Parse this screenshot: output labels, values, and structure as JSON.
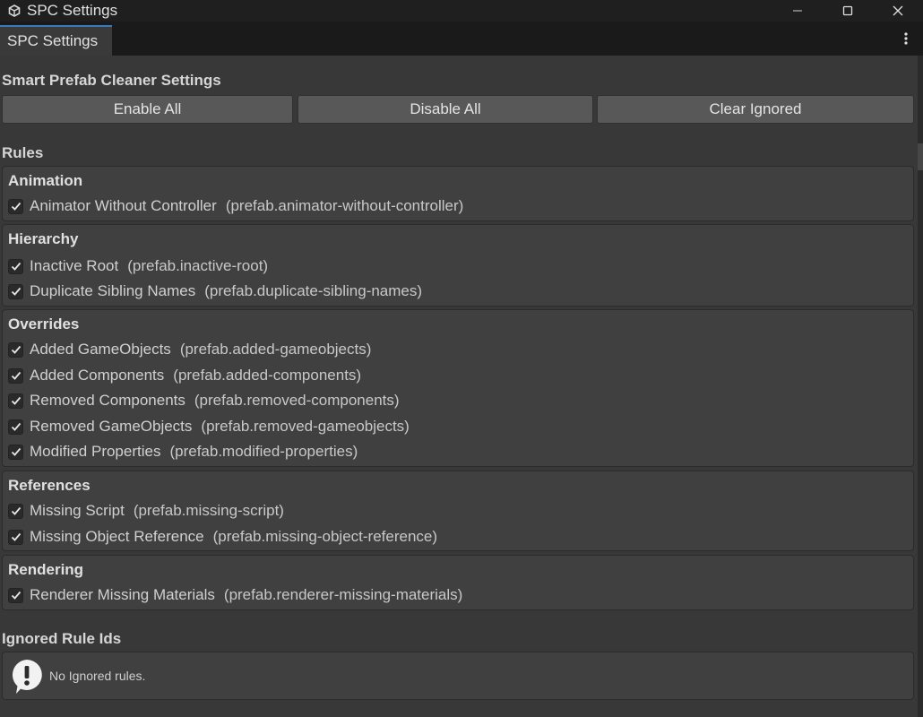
{
  "window": {
    "title": "SPC Settings"
  },
  "tab": {
    "label": "SPC Settings"
  },
  "header": "Smart Prefab Cleaner Settings",
  "buttons": {
    "enable_all": "Enable All",
    "disable_all": "Disable All",
    "clear_ignored": "Clear Ignored"
  },
  "rules_label": "Rules",
  "groups": [
    {
      "title": "Animation",
      "rules": [
        {
          "name": "Animator Without Controller",
          "id": "(prefab.animator-without-controller)",
          "checked": true
        }
      ]
    },
    {
      "title": "Hierarchy",
      "rules": [
        {
          "name": "Inactive Root",
          "id": "(prefab.inactive-root)",
          "checked": true
        },
        {
          "name": "Duplicate Sibling Names",
          "id": "(prefab.duplicate-sibling-names)",
          "checked": true
        }
      ]
    },
    {
      "title": "Overrides",
      "rules": [
        {
          "name": "Added GameObjects",
          "id": "(prefab.added-gameobjects)",
          "checked": true
        },
        {
          "name": "Added Components",
          "id": "(prefab.added-components)",
          "checked": true
        },
        {
          "name": "Removed Components",
          "id": "(prefab.removed-components)",
          "checked": true
        },
        {
          "name": "Removed GameObjects",
          "id": "(prefab.removed-gameobjects)",
          "checked": true
        },
        {
          "name": "Modified Properties",
          "id": "(prefab.modified-properties)",
          "checked": true
        }
      ]
    },
    {
      "title": "References",
      "rules": [
        {
          "name": "Missing Script",
          "id": "(prefab.missing-script)",
          "checked": true
        },
        {
          "name": "Missing Object Reference",
          "id": "(prefab.missing-object-reference)",
          "checked": true
        }
      ]
    },
    {
      "title": "Rendering",
      "rules": [
        {
          "name": "Renderer Missing Materials",
          "id": "(prefab.renderer-missing-materials)",
          "checked": true
        }
      ]
    }
  ],
  "ignored": {
    "label": "Ignored Rule Ids",
    "message": "No Ignored rules."
  },
  "colors": {
    "accent": "#3a79bb",
    "background": "#383838",
    "panel": "#404040",
    "button": "#585858"
  }
}
